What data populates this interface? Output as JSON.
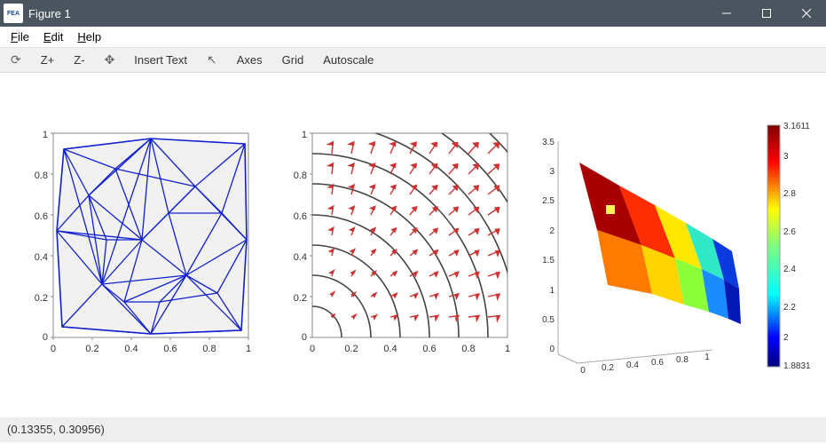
{
  "window": {
    "title": "Figure 1",
    "app_icon_text": "FEA"
  },
  "menubar": {
    "file": "File",
    "edit": "Edit",
    "help": "Help"
  },
  "toolbar": {
    "rotate": "⟳",
    "zplus": "Z+",
    "zminus": "Z-",
    "move": "✥",
    "insert_text": "Insert Text",
    "cursor": "↖",
    "axes": "Axes",
    "grid": "Grid",
    "autoscale": "Autoscale"
  },
  "statusbar": {
    "coords": "(0.13355, 0.30956)"
  },
  "chart_data": [
    {
      "type": "mesh2d",
      "title": "",
      "xlabel": "",
      "ylabel": "",
      "xlim": [
        0,
        1
      ],
      "ylim": [
        0,
        1
      ],
      "xticks": [
        0,
        0.2,
        0.4,
        0.6,
        0.8,
        1
      ],
      "yticks": [
        0,
        0.2,
        0.4,
        0.6,
        0.8,
        1
      ],
      "description": "Triangular FE mesh on roughly unit-square domain; outline ≈ square with slightly curved edges; dense interior Delaunay triangles (~80)",
      "edge_color": "#1020d0",
      "face_color": "#f1f1f1"
    },
    {
      "type": "contour+quiver",
      "xlabel": "",
      "ylabel": "",
      "xlim": [
        0,
        1
      ],
      "ylim": [
        0,
        1
      ],
      "xticks": [
        0,
        0.2,
        0.4,
        0.6,
        0.8,
        1
      ],
      "yticks": [
        0,
        0.2,
        0.4,
        0.6,
        0.8,
        1
      ],
      "contour_color": "#444",
      "contour_levels_approx": [
        0.15,
        0.3,
        0.45,
        0.6,
        0.75,
        0.9,
        1.05,
        1.2,
        1.35
      ],
      "contour_function": "concentric arcs centered lower-left (approx. quarter-circles of r = const)",
      "quiver_color": "#d03030",
      "quiver_grid_step": 0.1,
      "quiver_field": "vectors point roughly radially outward from lower-left, magnitude grows toward upper-right"
    },
    {
      "type": "surface3d",
      "xlim": [
        0,
        1
      ],
      "ylim": [
        0,
        1
      ],
      "xticks": [
        0,
        0.2,
        0.4,
        0.6,
        0.8,
        1
      ],
      "zlim": [
        0,
        3.5
      ],
      "zticks": [
        0,
        0.5,
        1,
        1.5,
        2,
        2.5,
        3,
        3.5
      ],
      "colorbar": {
        "min": 1.8831,
        "max": 3.16113,
        "ticks": [
          2,
          2.2,
          2.4,
          2.6,
          2.8,
          3
        ]
      },
      "colormap": "jet",
      "surface": "scalar field on unit square; low ≈1.88 at (1,0) rising to high ≈3.16 at (0,1)"
    }
  ]
}
